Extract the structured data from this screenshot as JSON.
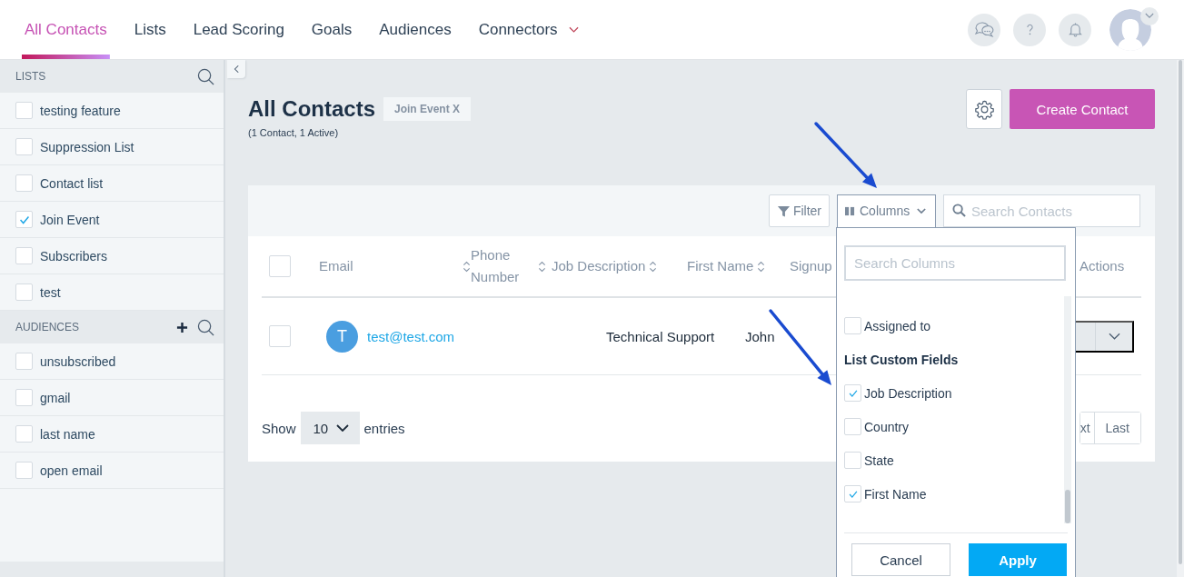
{
  "nav": {
    "tabs": [
      {
        "label": "All Contacts",
        "selected": true,
        "has_menu": false
      },
      {
        "label": "Lists",
        "selected": false,
        "has_menu": false
      },
      {
        "label": "Lead Scoring",
        "selected": false,
        "has_menu": false
      },
      {
        "label": "Goals",
        "selected": false,
        "has_menu": false
      },
      {
        "label": "Audiences",
        "selected": false,
        "has_menu": false
      },
      {
        "label": "Connectors",
        "selected": false,
        "has_menu": true
      }
    ]
  },
  "sidebar": {
    "lists_heading": "LISTS",
    "lists": [
      {
        "label": "testing feature",
        "checked": false
      },
      {
        "label": "Suppression List",
        "checked": false
      },
      {
        "label": "Contact list",
        "checked": false
      },
      {
        "label": "Join Event",
        "checked": true
      },
      {
        "label": "Subscribers",
        "checked": false
      },
      {
        "label": "test",
        "checked": false
      }
    ],
    "audiences_heading": "AUDIENCES",
    "audiences": [
      {
        "label": "unsubscribed",
        "checked": false
      },
      {
        "label": "gmail",
        "checked": false
      },
      {
        "label": "last name",
        "checked": false
      },
      {
        "label": "open email",
        "checked": false
      }
    ]
  },
  "page": {
    "title": "All Contacts",
    "filter_tag": "Join Event X",
    "subtitle": "(1 Contact, 1 Active)",
    "create_button": "Create Contact"
  },
  "toolbar": {
    "filter_button": "Filter",
    "columns_button": "Columns",
    "search": {
      "placeholder": "Search Contacts"
    }
  },
  "table": {
    "select_all_checked": false,
    "columns": [
      {
        "label": "Email",
        "sortable": true
      },
      {
        "label": "Phone Number",
        "sortable": true
      },
      {
        "label": "Job Description",
        "sortable": true
      },
      {
        "label": "First Name",
        "sortable": true
      },
      {
        "label": "Signup",
        "sortable": false
      },
      {
        "label": "Actions",
        "sortable": false
      }
    ],
    "rows": [
      {
        "checked": false,
        "avatar": "T",
        "email": "test@test.com",
        "job_description": "Technical Support",
        "first_name": "John"
      }
    ]
  },
  "footer": {
    "show_label": "Show",
    "page_size": "10",
    "entries_label": "entries",
    "pagination": [
      "xt",
      "Last"
    ]
  },
  "columns_menu": {
    "search": {
      "placeholder": "Search Columns"
    },
    "items": [
      {
        "kind": "option",
        "label": "Assigned to",
        "checked": false
      },
      {
        "kind": "heading",
        "label": "List Custom Fields"
      },
      {
        "kind": "option",
        "label": "Job Description",
        "checked": true
      },
      {
        "kind": "option",
        "label": "Country",
        "checked": false
      },
      {
        "kind": "option",
        "label": "State",
        "checked": false
      },
      {
        "kind": "option",
        "label": "First Name",
        "checked": true
      }
    ],
    "cancel": "Cancel",
    "apply": "Apply"
  }
}
